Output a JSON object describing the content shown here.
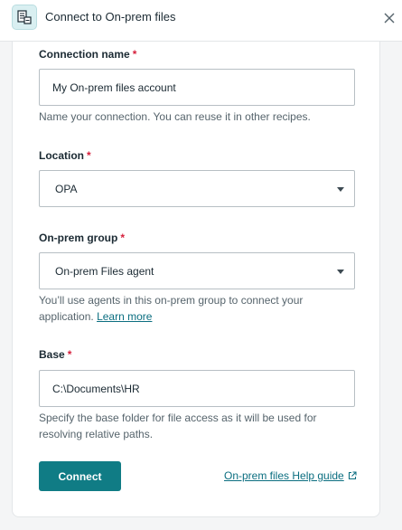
{
  "header": {
    "title": "Connect to On-prem files",
    "app_icon": "file-server-icon",
    "close_icon": "close-icon"
  },
  "form": {
    "connection_name": {
      "label": "Connection name",
      "required_mark": "*",
      "value": "My On-prem files account",
      "help": "Name your connection. You can reuse it in other recipes."
    },
    "location": {
      "label": "Location",
      "required_mark": "*",
      "selected": "OPA"
    },
    "on_prem_group": {
      "label": "On-prem group",
      "required_mark": "*",
      "selected": "On-prem Files agent",
      "help": "You’ll use agents in this on-prem group to connect your application.",
      "learn_more": "Learn more"
    },
    "base": {
      "label": "Base",
      "required_mark": "*",
      "value": "C:\\Documents\\HR",
      "help": "Specify the base folder for file access as it will be used for resolving relative paths."
    }
  },
  "footer": {
    "connect_label": "Connect",
    "help_guide_label": "On-prem files Help guide",
    "external_link_icon": "external-link-icon"
  },
  "colors": {
    "accent": "#107c85",
    "link": "#0b6e80",
    "required": "#d6203c"
  }
}
